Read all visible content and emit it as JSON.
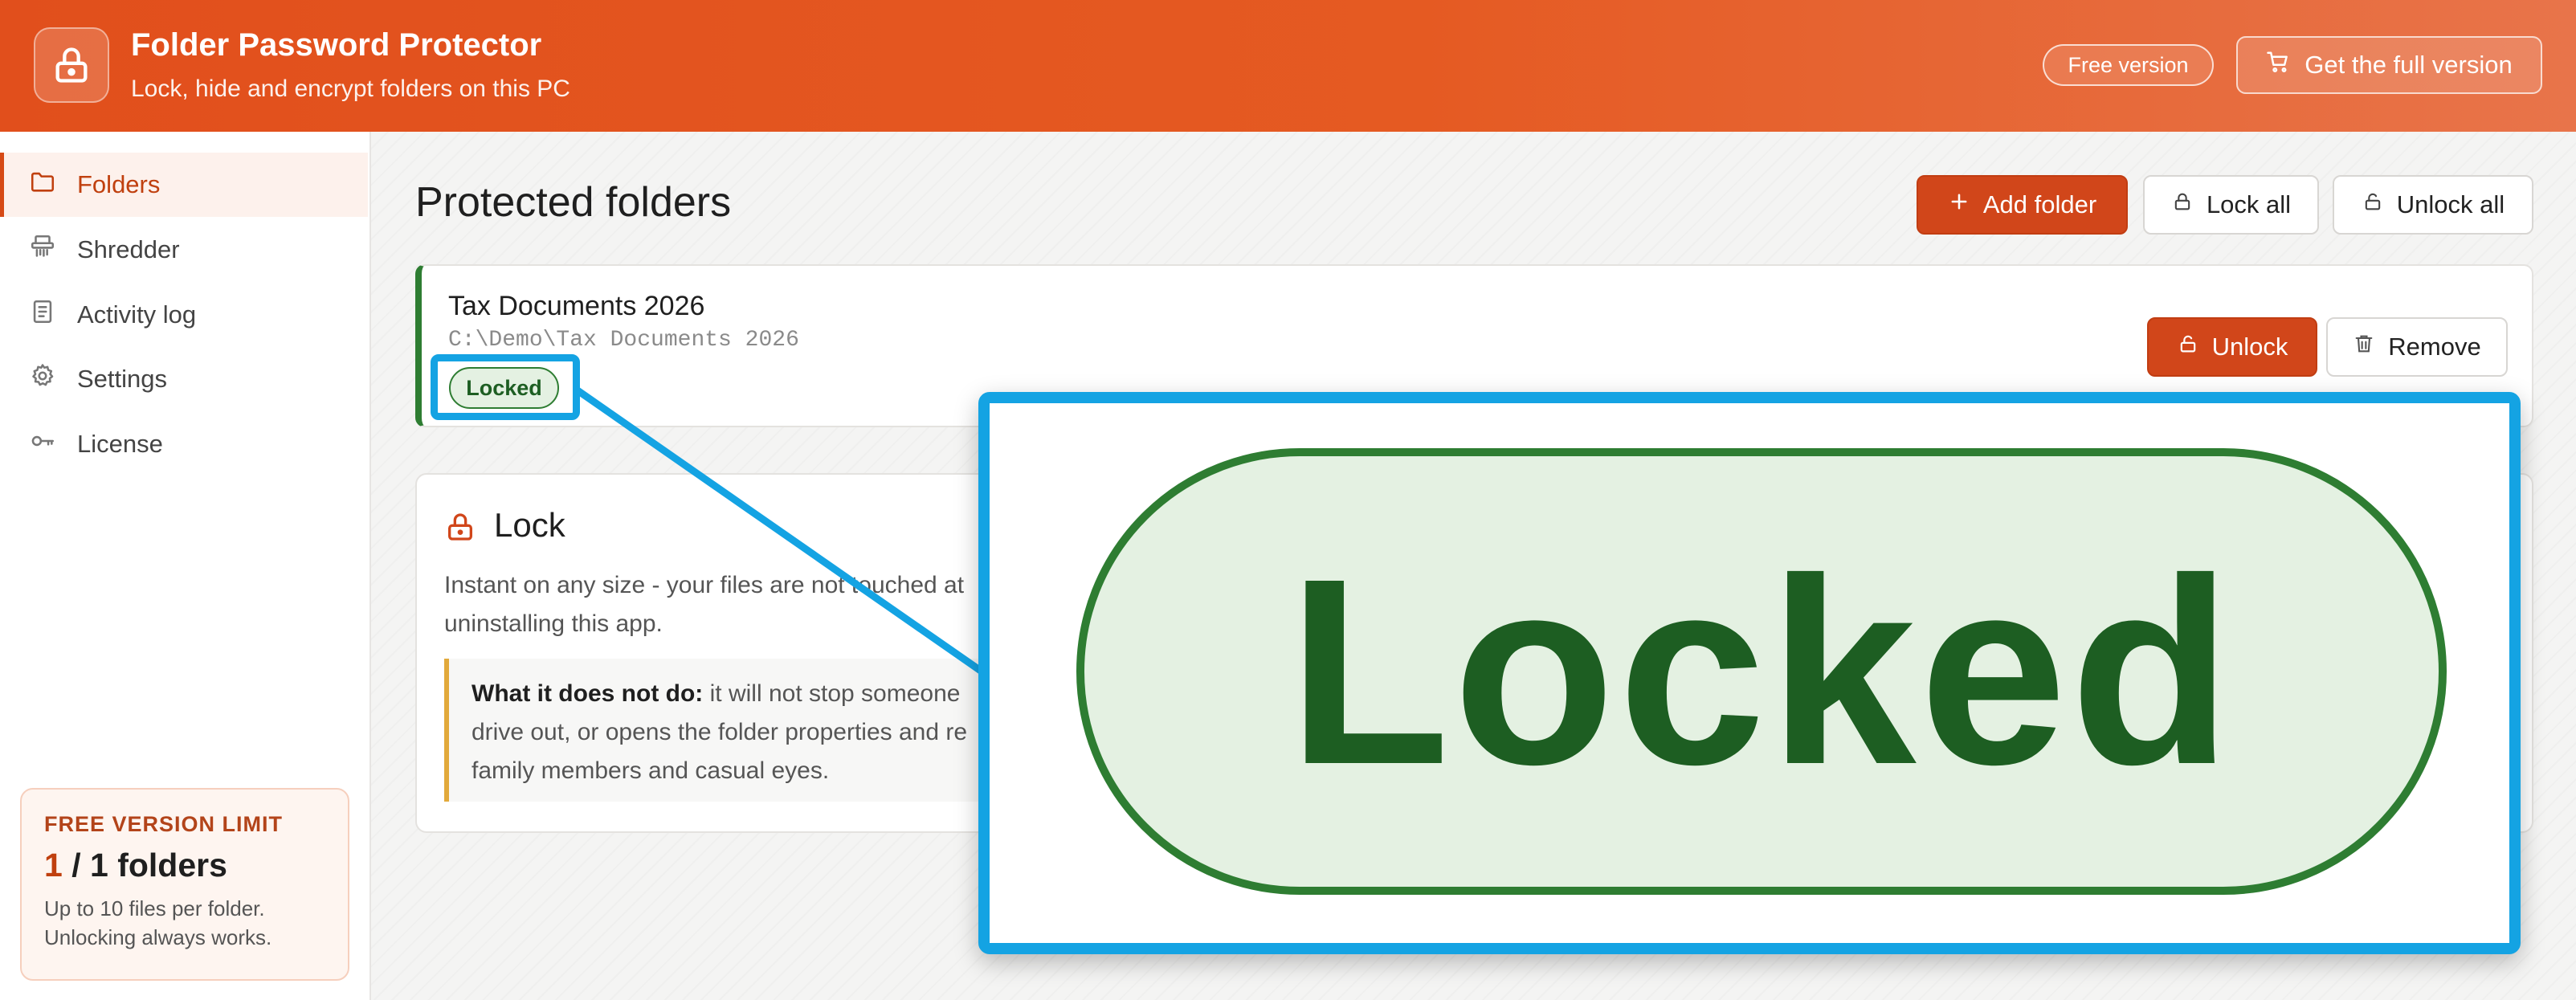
{
  "header": {
    "app_title": "Folder Password Protector",
    "app_subtitle": "Lock, hide and encrypt folders on this PC",
    "free_badge": "Free version",
    "full_version_label": "Get the full version",
    "logo_icon": "padlock-icon",
    "cart_icon": "cart-icon",
    "accent_color": "#e14f1c"
  },
  "sidebar": {
    "items": [
      {
        "label": "Folders",
        "icon": "folder-icon",
        "active": true
      },
      {
        "label": "Shredder",
        "icon": "shredder-icon",
        "active": false
      },
      {
        "label": "Activity log",
        "icon": "document-icon",
        "active": false
      },
      {
        "label": "Settings",
        "icon": "gear-icon",
        "active": false
      },
      {
        "label": "License",
        "icon": "key-icon",
        "active": false
      }
    ],
    "limit": {
      "title": "FREE VERSION LIMIT",
      "used": "1",
      "total": "/ 1 folders",
      "note_line1": "Up to 10 files per folder.",
      "note_line2": "Unlocking always works."
    }
  },
  "main": {
    "page_title": "Protected folders",
    "toolbar": {
      "add_folder": "Add folder",
      "lock_all": "Lock all",
      "unlock_all": "Unlock all"
    },
    "folders": [
      {
        "name": "Tax Documents 2026",
        "path": "C:\\Demo\\Tax Documents 2026",
        "status": "Locked",
        "status_color": "#2e7d32",
        "unlock_label": "Unlock",
        "remove_label": "Remove"
      }
    ],
    "lock_info": {
      "title": "Lock",
      "desc_line1": "Instant on any size - your files are not touched at",
      "desc_line2": "uninstalling this app.",
      "warn_bold": "What it does not do:",
      "warn_line1": " it will not stop someone",
      "warn_line2": "drive out, or opens the folder properties and re",
      "warn_line3": "family members and casual eyes."
    }
  },
  "zoom": {
    "label": "Locked",
    "highlight_color": "#14a3e3"
  }
}
